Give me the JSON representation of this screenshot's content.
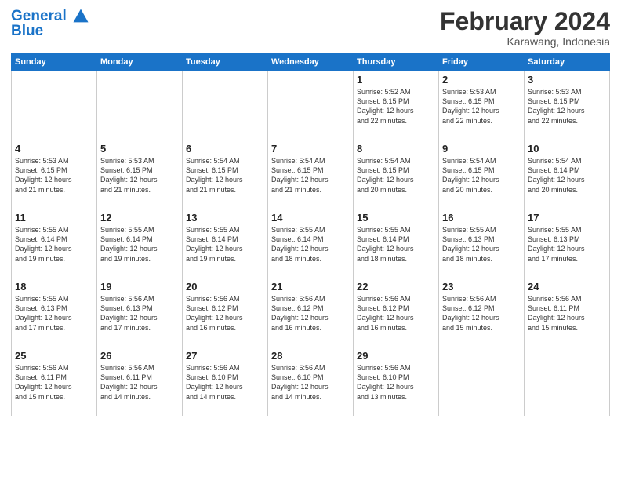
{
  "header": {
    "logo_line1": "General",
    "logo_line2": "Blue",
    "month": "February 2024",
    "location": "Karawang, Indonesia"
  },
  "weekdays": [
    "Sunday",
    "Monday",
    "Tuesday",
    "Wednesday",
    "Thursday",
    "Friday",
    "Saturday"
  ],
  "weeks": [
    [
      {
        "day": "",
        "info": ""
      },
      {
        "day": "",
        "info": ""
      },
      {
        "day": "",
        "info": ""
      },
      {
        "day": "",
        "info": ""
      },
      {
        "day": "1",
        "info": "Sunrise: 5:52 AM\nSunset: 6:15 PM\nDaylight: 12 hours\nand 22 minutes."
      },
      {
        "day": "2",
        "info": "Sunrise: 5:53 AM\nSunset: 6:15 PM\nDaylight: 12 hours\nand 22 minutes."
      },
      {
        "day": "3",
        "info": "Sunrise: 5:53 AM\nSunset: 6:15 PM\nDaylight: 12 hours\nand 22 minutes."
      }
    ],
    [
      {
        "day": "4",
        "info": "Sunrise: 5:53 AM\nSunset: 6:15 PM\nDaylight: 12 hours\nand 21 minutes."
      },
      {
        "day": "5",
        "info": "Sunrise: 5:53 AM\nSunset: 6:15 PM\nDaylight: 12 hours\nand 21 minutes."
      },
      {
        "day": "6",
        "info": "Sunrise: 5:54 AM\nSunset: 6:15 PM\nDaylight: 12 hours\nand 21 minutes."
      },
      {
        "day": "7",
        "info": "Sunrise: 5:54 AM\nSunset: 6:15 PM\nDaylight: 12 hours\nand 21 minutes."
      },
      {
        "day": "8",
        "info": "Sunrise: 5:54 AM\nSunset: 6:15 PM\nDaylight: 12 hours\nand 20 minutes."
      },
      {
        "day": "9",
        "info": "Sunrise: 5:54 AM\nSunset: 6:15 PM\nDaylight: 12 hours\nand 20 minutes."
      },
      {
        "day": "10",
        "info": "Sunrise: 5:54 AM\nSunset: 6:14 PM\nDaylight: 12 hours\nand 20 minutes."
      }
    ],
    [
      {
        "day": "11",
        "info": "Sunrise: 5:55 AM\nSunset: 6:14 PM\nDaylight: 12 hours\nand 19 minutes."
      },
      {
        "day": "12",
        "info": "Sunrise: 5:55 AM\nSunset: 6:14 PM\nDaylight: 12 hours\nand 19 minutes."
      },
      {
        "day": "13",
        "info": "Sunrise: 5:55 AM\nSunset: 6:14 PM\nDaylight: 12 hours\nand 19 minutes."
      },
      {
        "day": "14",
        "info": "Sunrise: 5:55 AM\nSunset: 6:14 PM\nDaylight: 12 hours\nand 18 minutes."
      },
      {
        "day": "15",
        "info": "Sunrise: 5:55 AM\nSunset: 6:14 PM\nDaylight: 12 hours\nand 18 minutes."
      },
      {
        "day": "16",
        "info": "Sunrise: 5:55 AM\nSunset: 6:13 PM\nDaylight: 12 hours\nand 18 minutes."
      },
      {
        "day": "17",
        "info": "Sunrise: 5:55 AM\nSunset: 6:13 PM\nDaylight: 12 hours\nand 17 minutes."
      }
    ],
    [
      {
        "day": "18",
        "info": "Sunrise: 5:55 AM\nSunset: 6:13 PM\nDaylight: 12 hours\nand 17 minutes."
      },
      {
        "day": "19",
        "info": "Sunrise: 5:56 AM\nSunset: 6:13 PM\nDaylight: 12 hours\nand 17 minutes."
      },
      {
        "day": "20",
        "info": "Sunrise: 5:56 AM\nSunset: 6:12 PM\nDaylight: 12 hours\nand 16 minutes."
      },
      {
        "day": "21",
        "info": "Sunrise: 5:56 AM\nSunset: 6:12 PM\nDaylight: 12 hours\nand 16 minutes."
      },
      {
        "day": "22",
        "info": "Sunrise: 5:56 AM\nSunset: 6:12 PM\nDaylight: 12 hours\nand 16 minutes."
      },
      {
        "day": "23",
        "info": "Sunrise: 5:56 AM\nSunset: 6:12 PM\nDaylight: 12 hours\nand 15 minutes."
      },
      {
        "day": "24",
        "info": "Sunrise: 5:56 AM\nSunset: 6:11 PM\nDaylight: 12 hours\nand 15 minutes."
      }
    ],
    [
      {
        "day": "25",
        "info": "Sunrise: 5:56 AM\nSunset: 6:11 PM\nDaylight: 12 hours\nand 15 minutes."
      },
      {
        "day": "26",
        "info": "Sunrise: 5:56 AM\nSunset: 6:11 PM\nDaylight: 12 hours\nand 14 minutes."
      },
      {
        "day": "27",
        "info": "Sunrise: 5:56 AM\nSunset: 6:10 PM\nDaylight: 12 hours\nand 14 minutes."
      },
      {
        "day": "28",
        "info": "Sunrise: 5:56 AM\nSunset: 6:10 PM\nDaylight: 12 hours\nand 14 minutes."
      },
      {
        "day": "29",
        "info": "Sunrise: 5:56 AM\nSunset: 6:10 PM\nDaylight: 12 hours\nand 13 minutes."
      },
      {
        "day": "",
        "info": ""
      },
      {
        "day": "",
        "info": ""
      }
    ]
  ]
}
